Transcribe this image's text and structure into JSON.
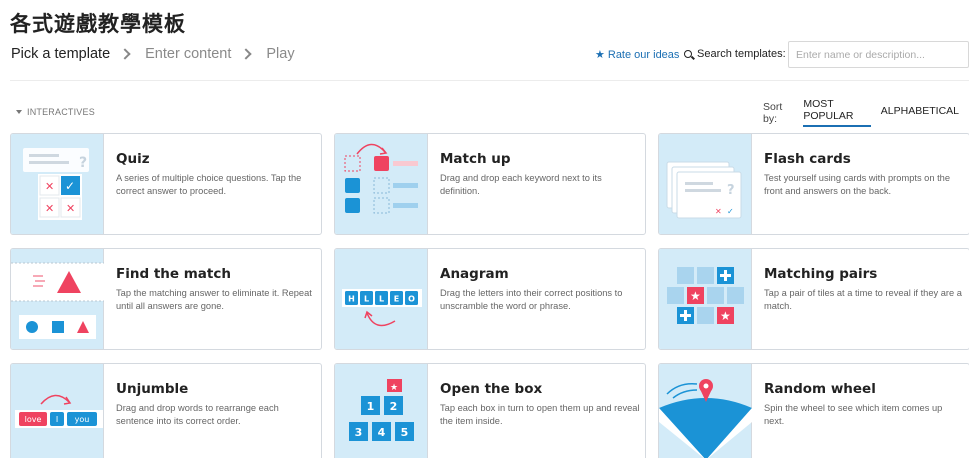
{
  "page": {
    "title": "各式遊戲教學模板"
  },
  "steps": [
    {
      "label": "Pick a template"
    },
    {
      "label": "Enter content"
    },
    {
      "label": "Play"
    }
  ],
  "toolbar": {
    "rate_label": "Rate our ideas",
    "search_label": "Search templates:",
    "search_placeholder": "Enter name or description...",
    "search_value": ""
  },
  "section": {
    "label": "INTERACTIVES"
  },
  "sort": {
    "label": "Sort by:",
    "options": [
      {
        "label": "MOST POPULAR",
        "active": true
      },
      {
        "label": "ALPHABETICAL",
        "active": false
      }
    ]
  },
  "colors": {
    "accent": "#1b6fb3",
    "thumb_bg": "#d3ebf8",
    "red": "#ef4360",
    "blue": "#1b93d6"
  },
  "templates": [
    {
      "name": "Quiz",
      "description": "A series of multiple choice questions. Tap the correct answer to proceed.",
      "icon": "quiz-icon"
    },
    {
      "name": "Match up",
      "description": "Drag and drop each keyword next to its definition.",
      "icon": "match-up-icon"
    },
    {
      "name": "Flash cards",
      "description": "Test yourself using cards with prompts on the front and answers on the back.",
      "icon": "flash-cards-icon"
    },
    {
      "name": "Find the match",
      "description": "Tap the matching answer to eliminate it. Repeat until all answers are gone.",
      "icon": "find-the-match-icon"
    },
    {
      "name": "Anagram",
      "description": "Drag the letters into their correct positions to unscramble the word or phrase.",
      "icon": "anagram-icon",
      "letters": [
        "H",
        "L",
        "L",
        "E",
        "O"
      ]
    },
    {
      "name": "Matching pairs",
      "description": "Tap a pair of tiles at a time to reveal if they are a match.",
      "icon": "matching-pairs-icon"
    },
    {
      "name": "Unjumble",
      "description": "Drag and drop words to rearrange each sentence into its correct order.",
      "icon": "unjumble-icon",
      "words": [
        "love",
        "I",
        "you"
      ]
    },
    {
      "name": "Open the box",
      "description": "Tap each box in turn to open them up and reveal the item inside.",
      "icon": "open-the-box-icon",
      "numbers": [
        "1",
        "2",
        "3",
        "4",
        "5"
      ]
    },
    {
      "name": "Random wheel",
      "description": "Spin the wheel to see which item comes up next.",
      "icon": "random-wheel-icon"
    }
  ]
}
